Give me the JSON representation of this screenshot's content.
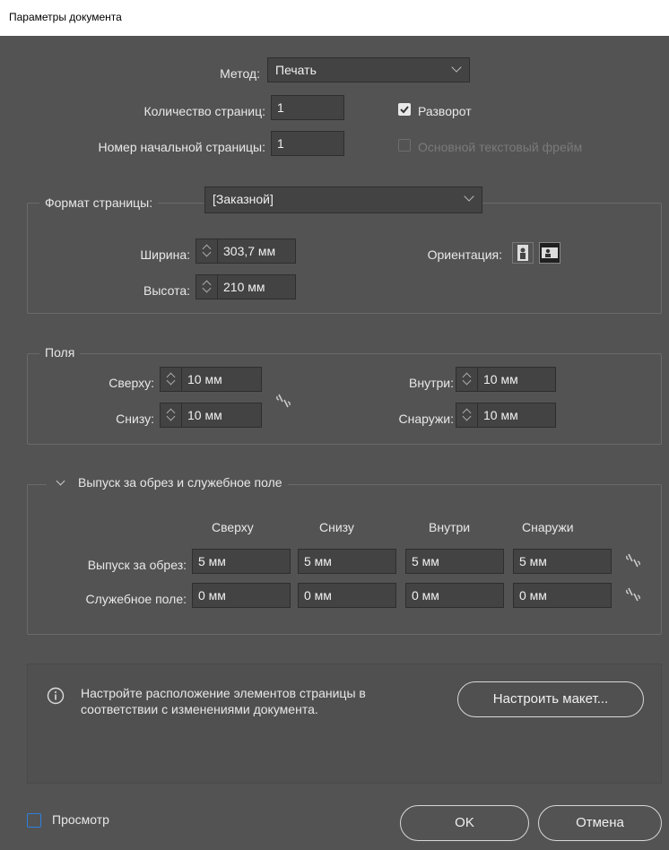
{
  "window": {
    "title": "Параметры документа"
  },
  "intent": {
    "label": "Метод:",
    "value": "Печать"
  },
  "pages": {
    "count_label": "Количество страниц:",
    "count_value": "1",
    "start_label": "Номер начальной страницы:",
    "start_value": "1",
    "facing_label": "Разворот",
    "facing_checked": true,
    "primary_frame_label": "Основной текстовый фрейм",
    "primary_frame_checked": false
  },
  "page_size": {
    "label": "Формат страницы:",
    "value": "[Заказной]",
    "width_label": "Ширина:",
    "width_value": "303,7 мм",
    "height_label": "Высота:",
    "height_value": "210 мм",
    "orientation_label": "Ориентация:"
  },
  "margins": {
    "title": "Поля",
    "top_label": "Сверху:",
    "top_value": "10 мм",
    "bottom_label": "Снизу:",
    "bottom_value": "10 мм",
    "inside_label": "Внутри:",
    "inside_value": "10 мм",
    "outside_label": "Снаружи:",
    "outside_value": "10 мм"
  },
  "bleed": {
    "title": "Выпуск за обрез и служебное поле",
    "col_top": "Сверху",
    "col_bottom": "Снизу",
    "col_inside": "Внутри",
    "col_outside": "Снаружи",
    "bleed_label": "Выпуск за обрез:",
    "bleed_values": [
      "5 мм",
      "5 мм",
      "5 мм",
      "5 мм"
    ],
    "slug_label": "Служебное поле:",
    "slug_values": [
      "0 мм",
      "0 мм",
      "0 мм",
      "0 мм"
    ]
  },
  "info": {
    "text": "Настройте расположение элементов страницы в соответствии с изменениями документа.",
    "button": "Настроить макет..."
  },
  "footer": {
    "preview_label": "Просмотр",
    "preview_checked": false,
    "ok": "OK",
    "cancel": "Отмена"
  },
  "colors": {
    "accent": "#2f7fe0",
    "checkbox_on": "#e8e8e8",
    "disabled": "#7a7a7a"
  }
}
